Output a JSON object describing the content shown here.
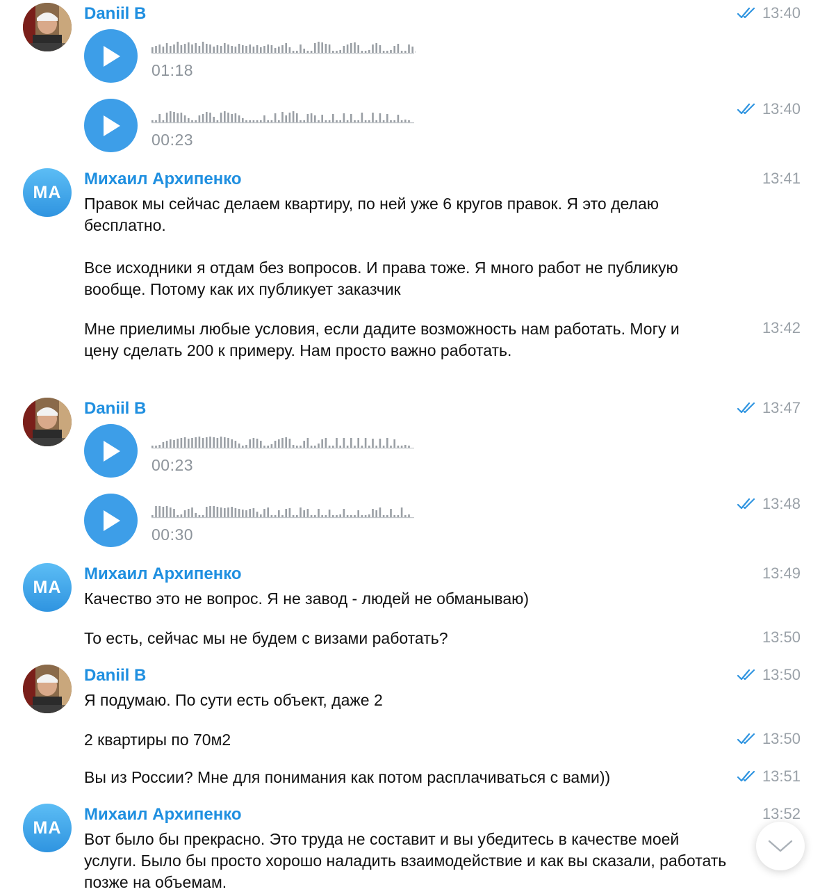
{
  "participants": {
    "daniil": {
      "name": "Daniil B"
    },
    "mikhail": {
      "name": "Михаил Архипенко",
      "initials": "MA"
    }
  },
  "messages": [
    {
      "id": "v1",
      "type": "voice",
      "duration": "01:18",
      "time": "13:40",
      "read": true
    },
    {
      "id": "v2",
      "type": "voice",
      "duration": "00:23",
      "time": "13:40",
      "read": true
    },
    {
      "id": "t1",
      "type": "text",
      "text": "Правок мы сейчас делаем квартиру, по ней уже 6 кругов правок.  Я это делаю бесплатно.",
      "time": "13:41"
    },
    {
      "id": "t2",
      "type": "text",
      "text": "Все исходники я отдам без вопросов. И права тоже.  Я много работ не публикую вообще.  Потому как их публикует заказчик"
    },
    {
      "id": "t3",
      "type": "text",
      "text": "Мне приелимы любые условия,  если дадите возможность нам работать. Могу и цену сделать 200 к примеру.  Нам просто важно работать.",
      "time": "13:42"
    },
    {
      "id": "v3",
      "type": "voice",
      "duration": "00:23",
      "time": "13:47",
      "read": true
    },
    {
      "id": "v4",
      "type": "voice",
      "duration": "00:30",
      "time": "13:48",
      "read": true
    },
    {
      "id": "t4",
      "type": "text",
      "text": "Качество это не вопрос.  Я не завод - людей не обманываю)",
      "time": "13:49"
    },
    {
      "id": "t5",
      "type": "text",
      "text": "То есть,  сейчас мы не будем с визами работать?",
      "time": "13:50"
    },
    {
      "id": "t6",
      "type": "text",
      "text": "Я подумаю. По сути есть объект, даже 2",
      "time": "13:50",
      "read": true
    },
    {
      "id": "t7",
      "type": "text",
      "text": "2 квартиры по 70м2",
      "time": "13:50",
      "read": true
    },
    {
      "id": "t8",
      "type": "text",
      "text": "Вы из России? Мне для понимания как потом расплачиваться с вами))",
      "time": "13:51",
      "read": true
    },
    {
      "id": "t9",
      "type": "text",
      "text": "Вот было бы прекрасно.  Это труда не составит и вы убедитесь в качестве моей услуги. Было бы просто хорошо наладить взаимодействие и как вы сказали,  работать позже на объемам.",
      "time": "13:52"
    }
  ],
  "icons": {
    "play": "play-icon",
    "read_receipt": "double-check-icon",
    "scroll_down": "chevron-down-icon"
  },
  "colors": {
    "accent": "#1f8fe0",
    "play_button": "#3d9ee8",
    "timestamp": "#9aa1a8",
    "waveform": "#9a9fa5"
  }
}
